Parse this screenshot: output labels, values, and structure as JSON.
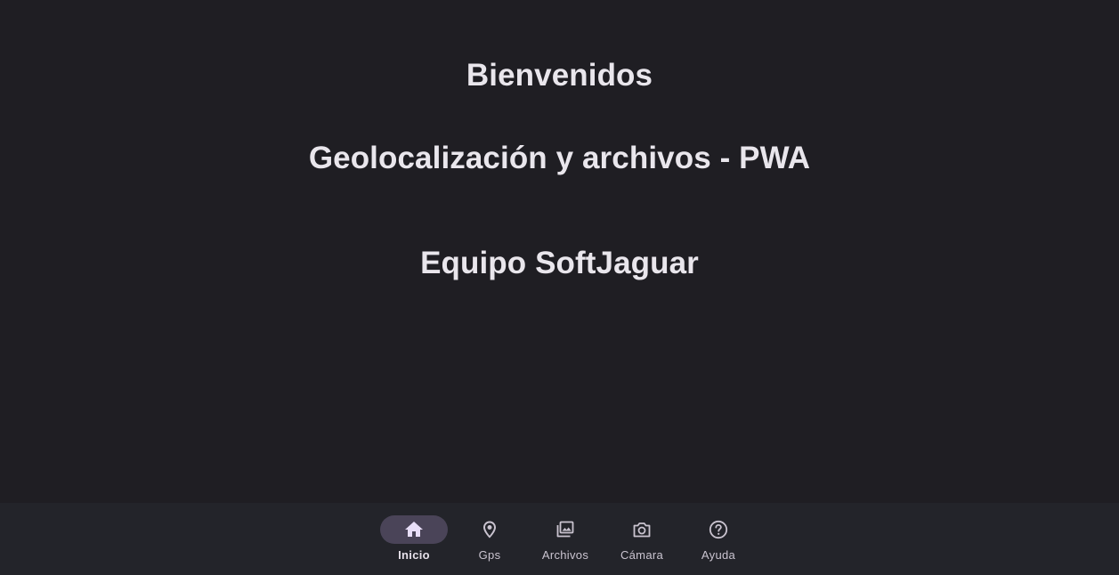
{
  "main": {
    "welcome": "Bienvenidos",
    "subtitle": "Geolocalización y archivos - PWA",
    "team": "Equipo SoftJaguar"
  },
  "bottom_nav": {
    "items": [
      {
        "label": "Inicio",
        "icon": "home-icon",
        "active": true
      },
      {
        "label": "Gps",
        "icon": "location-pin-icon",
        "active": false
      },
      {
        "label": "Archivos",
        "icon": "photo-library-icon",
        "active": false
      },
      {
        "label": "Cámara",
        "icon": "camera-icon",
        "active": false
      },
      {
        "label": "Ayuda",
        "icon": "help-circle-icon",
        "active": false
      }
    ]
  },
  "colors": {
    "background": "#1f1e23",
    "nav_background": "#23242a",
    "active_indicator": "#4a4458",
    "active_icon": "#e8def8",
    "text": "#e7e4ea",
    "nav_text": "#cac4d0"
  }
}
